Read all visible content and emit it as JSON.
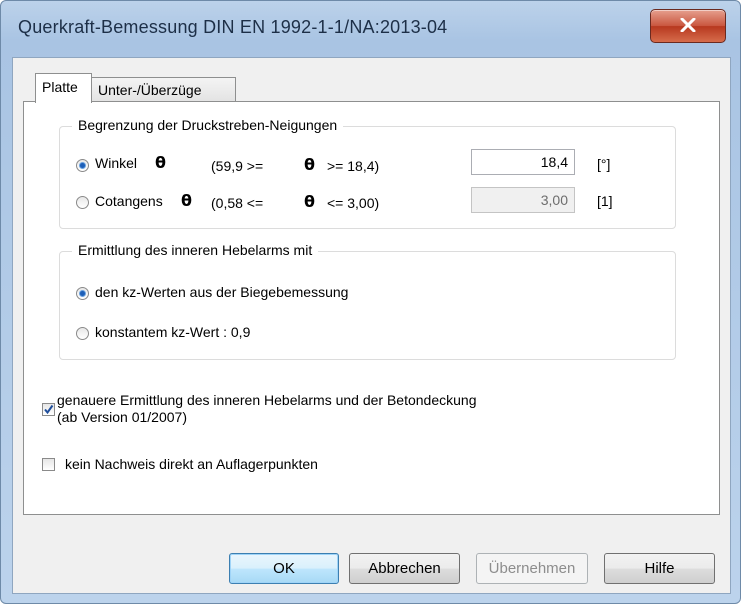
{
  "window": {
    "title": "Querkraft-Bemessung DIN EN 1992-1-1/NA:2013-04"
  },
  "tabs": [
    {
      "label": "Platte",
      "active": true
    },
    {
      "label": "Unter-/Überzüge",
      "active": false
    }
  ],
  "strut_group": {
    "legend": "Begrenzung der Druckstreben-Neigungen",
    "theta_symbol": "θ",
    "rows": [
      {
        "option_label": "Winkel",
        "selected": true,
        "range_left": "(59,9 >=",
        "range_right": ">= 18,4)",
        "value": "18,4",
        "unit": "[°]",
        "enabled": true
      },
      {
        "option_label": "Cotangens",
        "selected": false,
        "range_left": "(0,58 <=",
        "range_right": "<= 3,00)",
        "value": "3,00",
        "unit": "[1]",
        "enabled": false
      }
    ]
  },
  "lever_group": {
    "legend": "Ermittlung des inneren Hebelarms mit",
    "options": [
      {
        "label": "den kz-Werten aus der Biegebemessung",
        "selected": true
      },
      {
        "label": "konstantem kz-Wert : 0,9",
        "selected": false
      }
    ]
  },
  "checkboxes": [
    {
      "label_line1": "genauere Ermittlung des inneren Hebelarms und der Betondeckung",
      "label_line2": "(ab Version 01/2007)",
      "checked": true
    },
    {
      "label_line1": "kein Nachweis direkt an Auflagerpunkten",
      "checked": false
    }
  ],
  "buttons": {
    "ok": "OK",
    "cancel": "Abbrechen",
    "apply": "Übernehmen",
    "help": "Hilfe"
  }
}
